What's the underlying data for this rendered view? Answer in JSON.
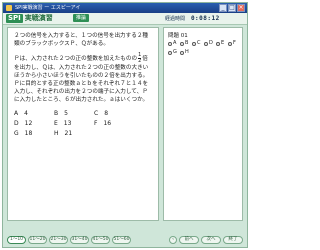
{
  "window": {
    "title": "SPI実戦演習 ー エスピーアイ"
  },
  "header": {
    "logo_badge": "SPI",
    "logo_text": "実戦演習",
    "category": "推論"
  },
  "timer": {
    "label": "経過時間",
    "value": "0:08:12"
  },
  "question": {
    "para1": "２つの信号を入力すると、１つの信号を出力する２種類のブラックボックスＰ、Ｑがある。",
    "para2_pre": "Ｐは、入力された２つの正の整数を加えたものの",
    "para2_frac_num": "1",
    "para2_frac_den": "2",
    "para2_post": "倍を出力し、Ｑは、入力された２つの正の整数の大きいほうから小さいほうを引いたものの２倍を出力する。Ｐに目的とする正の整数ａとｂをそれぞれ７と１４を入力し、それぞれの出力を２つの端子に入力して、Ｐに入力したところ、６が出力された。ａはいくつか。",
    "options": [
      {
        "key": "A",
        "value": "4"
      },
      {
        "key": "B",
        "value": "5"
      },
      {
        "key": "C",
        "value": "8"
      },
      {
        "key": "D",
        "value": "12"
      },
      {
        "key": "E",
        "value": "13"
      },
      {
        "key": "F",
        "value": "16"
      },
      {
        "key": "G",
        "value": "18"
      },
      {
        "key": "H",
        "value": "21"
      }
    ]
  },
  "answer_panel": {
    "question_no": "問題 01",
    "choices": [
      "A",
      "B",
      "C",
      "D",
      "E",
      "F",
      "G",
      "H"
    ]
  },
  "pager": {
    "tabs": [
      "1〜10",
      "11〜20",
      "21〜30",
      "31〜40",
      "41〜50",
      "51〜60"
    ]
  },
  "actions": {
    "prev": "前へ",
    "next": "次へ",
    "end": "終了"
  }
}
